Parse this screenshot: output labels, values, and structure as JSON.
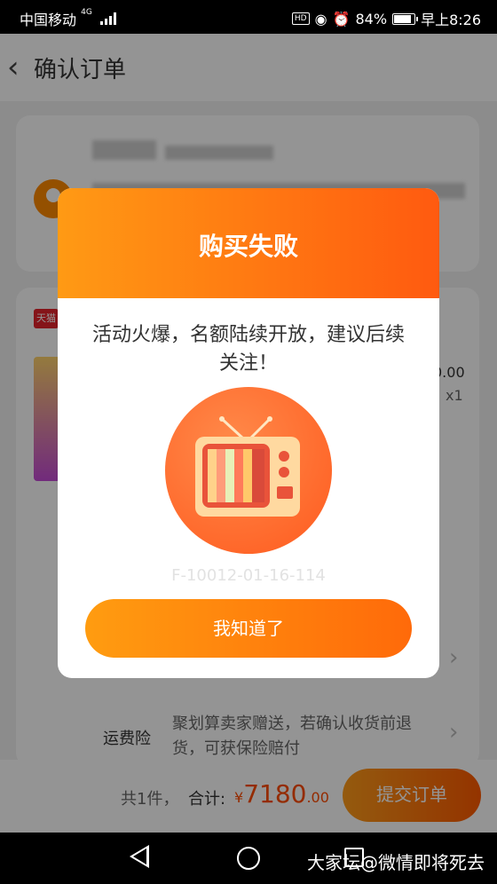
{
  "status_bar": {
    "carrier": "中国移动",
    "network": "4G",
    "hd": "HD",
    "battery": "84%",
    "time": "早上8:26"
  },
  "header": {
    "title": "确认订单"
  },
  "background": {
    "badge": "天猫",
    "price_fragment": "0.00",
    "quantity": "x1",
    "insurance_label": "运费险",
    "insurance_text": "聚划算卖家赠送，若确认收货前退货，可获保险赔付"
  },
  "bottom_bar": {
    "count": "共1件，",
    "total_label": "合计:",
    "currency": "¥",
    "total_int": "7180",
    "total_dec": ".00",
    "submit_label": "提交订单"
  },
  "dialog": {
    "title": "购买失败",
    "message": "活动火爆，名额陆续开放，建议后续关注！",
    "code": "F-10012-01-16-114",
    "button_label": "我知道了"
  },
  "nav": {
    "watermark": "大家坛@微情即将死去"
  }
}
